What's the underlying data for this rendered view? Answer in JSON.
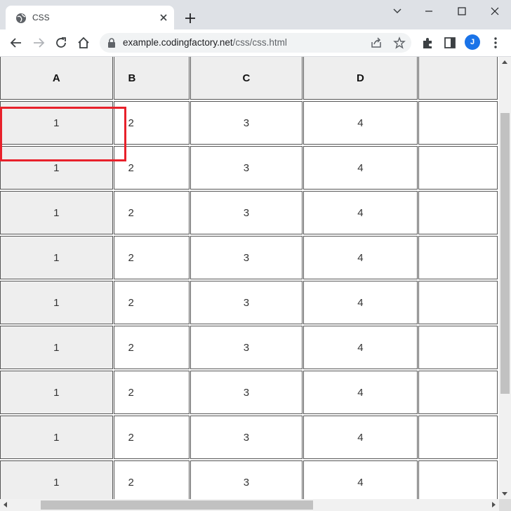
{
  "browser": {
    "tab_title": "CSS",
    "url_domain": "example.codingfactory.net",
    "url_path": "/css/css.html",
    "profile_initial": "J",
    "accent_color": "#1a73e8"
  },
  "table": {
    "headers": [
      "A",
      "B",
      "C",
      "D",
      ""
    ],
    "rows": [
      [
        "1",
        "2",
        "3",
        "4",
        ""
      ],
      [
        "1",
        "2",
        "3",
        "4",
        ""
      ],
      [
        "1",
        "2",
        "3",
        "4",
        ""
      ],
      [
        "1",
        "2",
        "3",
        "4",
        ""
      ],
      [
        "1",
        "2",
        "3",
        "4",
        ""
      ],
      [
        "1",
        "2",
        "3",
        "4",
        ""
      ],
      [
        "1",
        "2",
        "3",
        "4",
        ""
      ],
      [
        "1",
        "2",
        "3",
        "4",
        ""
      ],
      [
        "1",
        "2",
        "3",
        "4",
        ""
      ]
    ],
    "highlight_color": "#e8212b"
  }
}
